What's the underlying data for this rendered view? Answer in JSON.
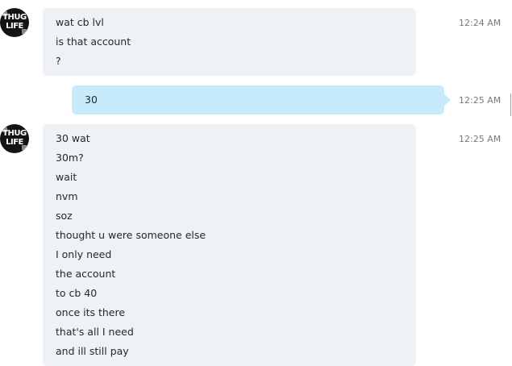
{
  "conversation": {
    "messages": [
      {
        "sender": "contact",
        "avatar_icon": "thug-life-avatar",
        "avatar_text_lines": [
          "THUG",
          "LIFE"
        ],
        "time": "12:24 AM",
        "lines": [
          "wat cb lvl",
          "is that account",
          "?"
        ]
      },
      {
        "sender": "self",
        "time": "12:25 AM",
        "lines": [
          "30"
        ]
      },
      {
        "sender": "contact",
        "avatar_icon": "thug-life-avatar",
        "avatar_text_lines": [
          "THUG",
          "LIFE"
        ],
        "time": "12:25 AM",
        "lines": [
          "30 wat",
          "30m?",
          "wait",
          "nvm",
          "soz",
          "thought u were someone else",
          "I only need",
          "the account",
          "to cb 40",
          "once its there",
          "that's all I need",
          "and ill still pay"
        ]
      }
    ]
  },
  "colors": {
    "contact_bubble": "#eef1f6",
    "self_bubble": "#c7ebfa",
    "timestamp": "#6f7c8a",
    "text": "#222a33"
  }
}
